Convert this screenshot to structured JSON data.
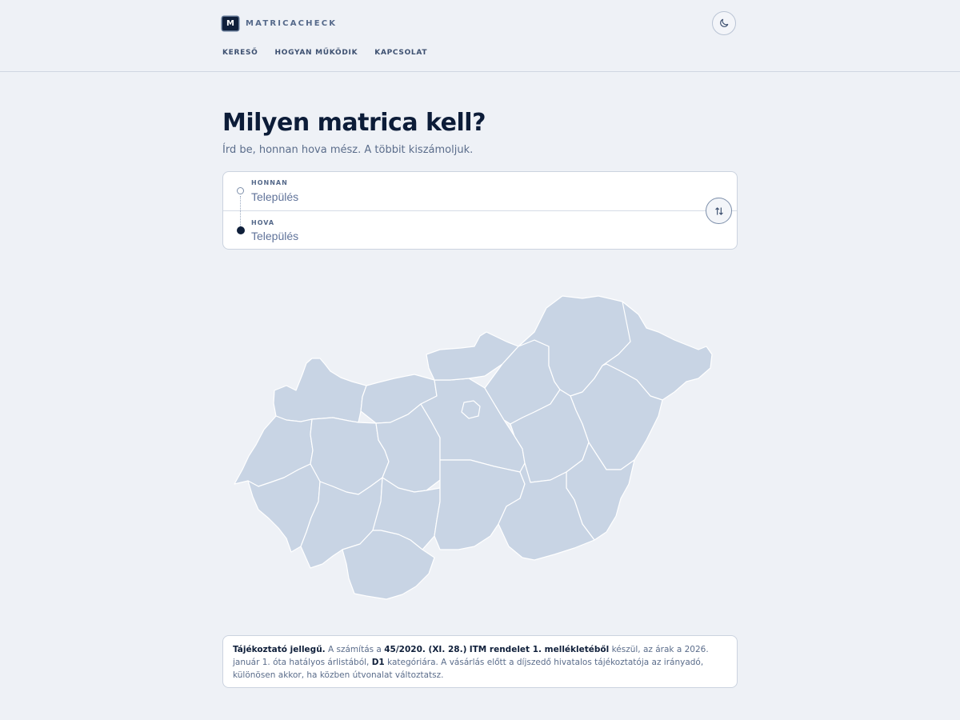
{
  "brand": {
    "logo_letter": "M",
    "name": "MATRICACHECK"
  },
  "nav": {
    "items": [
      {
        "label": "KERESŐ"
      },
      {
        "label": "HOGYAN MŰKÖDIK"
      },
      {
        "label": "KAPCSOLAT"
      }
    ]
  },
  "hero": {
    "title": "Milyen matrica kell?",
    "subtitle": "Írd be, honnan hova mész. A többit kiszámoljuk."
  },
  "route": {
    "from": {
      "label": "HONNAN",
      "placeholder": "Település",
      "value": ""
    },
    "to": {
      "label": "HOVA",
      "placeholder": "Település",
      "value": ""
    }
  },
  "disclaimer": {
    "lead": "Tájékoztató jellegű.",
    "t1": " A számítás a ",
    "regulation": "45/2020. (XI. 28.)",
    "t2": " ",
    "annex": "ITM rendelet 1. mellékletéből",
    "t3": " készül, az árak a 2026. január 1. óta hatályos árlistából, ",
    "category": "D1",
    "t4": " kategóriára. A vásárlás előtt a díjszedő hivatalos tájékoztatója az irányadó, különösen akkor, ha közben útvonalat változtatsz."
  },
  "icons": {
    "theme": "moon-icon",
    "swap": "swap-vertical-icon"
  },
  "colors": {
    "background": "#eef1f6",
    "primary": "#0f1f3a",
    "muted": "#5b6d8b",
    "map_fill": "#c8d4e4"
  }
}
